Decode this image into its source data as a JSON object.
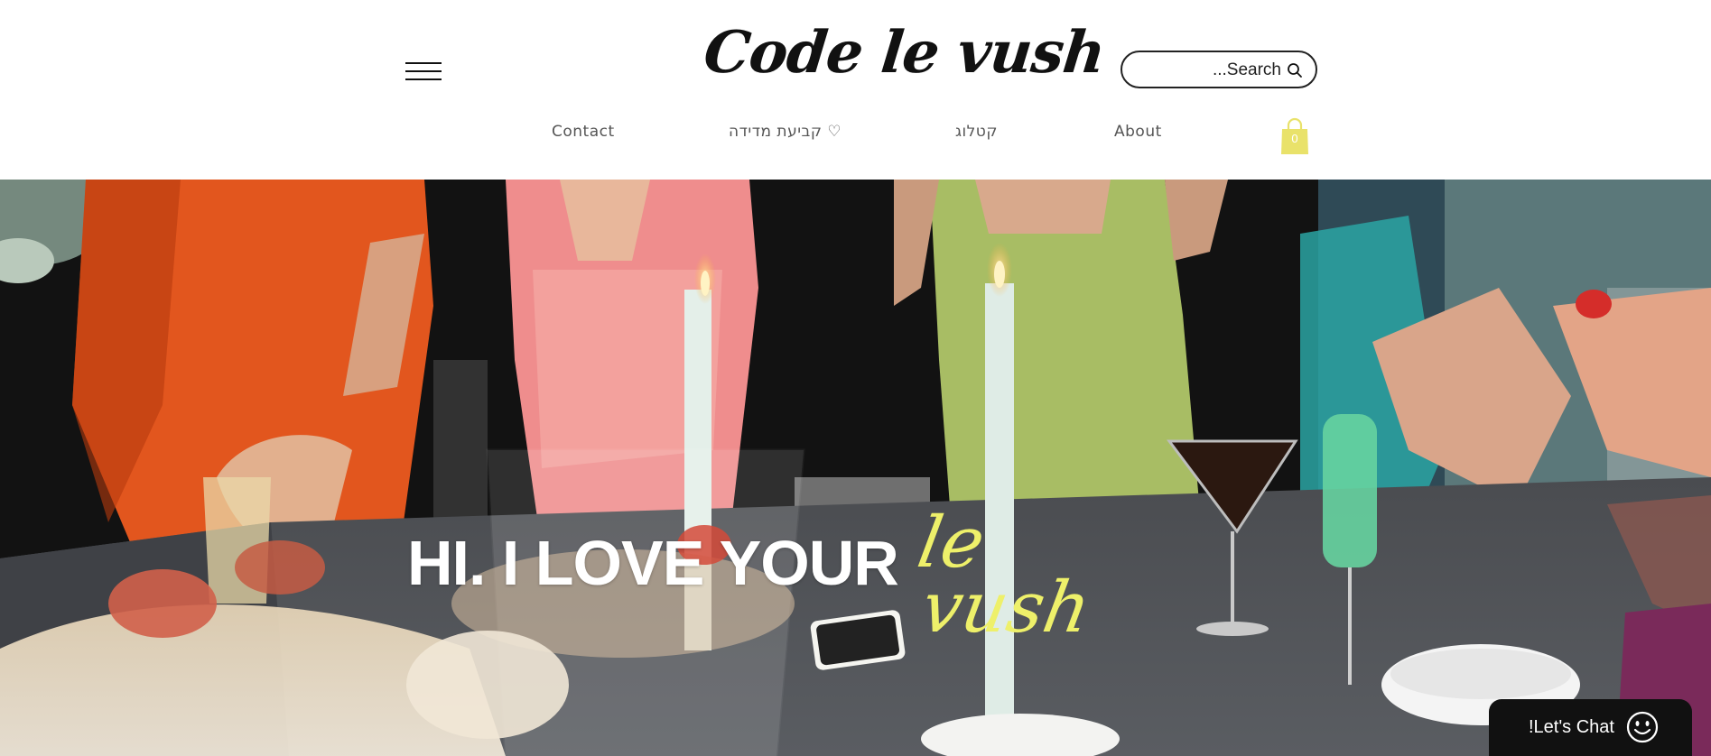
{
  "header": {
    "logo": "Code le vush",
    "search": {
      "placeholder": "Search...",
      "value": ""
    },
    "nav": {
      "contact": "Contact",
      "measure": "קביעת מדידה ♡",
      "catalog": "קטלוג",
      "about": "About"
    },
    "cart": {
      "count": "0",
      "color": "#e9e26a"
    },
    "icons": [
      "menu-icon",
      "search-icon",
      "shopping-bag-icon"
    ]
  },
  "hero": {
    "headline": "HI. I LOVE YOUR",
    "script_line_1": "le",
    "script_line_2": "vush",
    "accent_color": "#eef06a"
  },
  "chat": {
    "label": "!Let's Chat",
    "icon": "smile-icon"
  }
}
